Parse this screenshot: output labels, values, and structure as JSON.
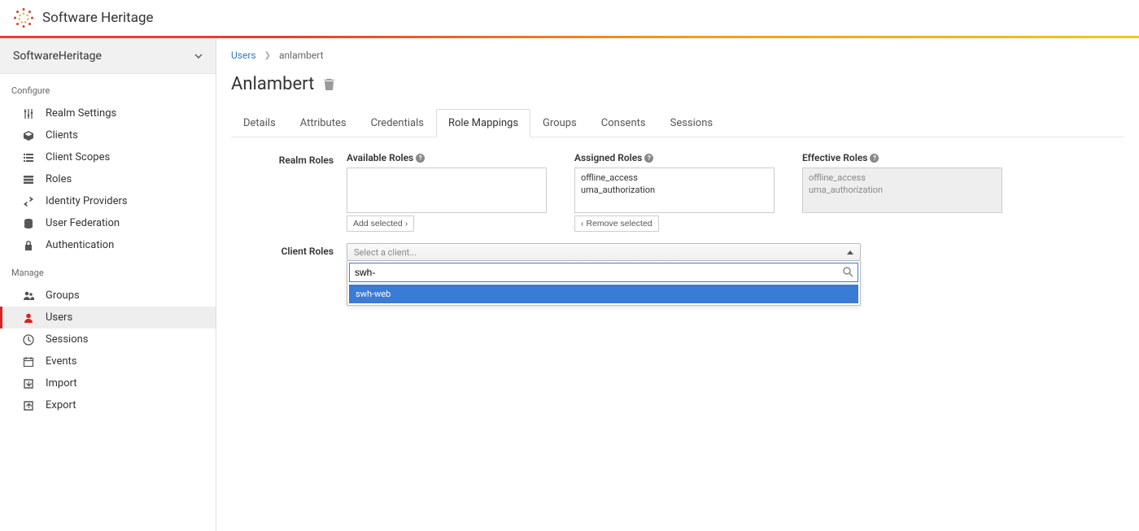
{
  "brand": {
    "text": "Software Heritage"
  },
  "realm": {
    "name": "SoftwareHeritage"
  },
  "sidebar": {
    "sections": {
      "configure_title": "Configure",
      "manage_title": "Manage"
    },
    "configure": [
      {
        "label": "Realm Settings",
        "icon": "sliders-icon"
      },
      {
        "label": "Clients",
        "icon": "cube-icon"
      },
      {
        "label": "Client Scopes",
        "icon": "list-icon"
      },
      {
        "label": "Roles",
        "icon": "layers-icon"
      },
      {
        "label": "Identity Providers",
        "icon": "exchange-icon"
      },
      {
        "label": "User Federation",
        "icon": "database-icon"
      },
      {
        "label": "Authentication",
        "icon": "lock-icon"
      }
    ],
    "manage": [
      {
        "label": "Groups",
        "icon": "group-icon"
      },
      {
        "label": "Users",
        "icon": "user-icon"
      },
      {
        "label": "Sessions",
        "icon": "clock-icon"
      },
      {
        "label": "Events",
        "icon": "calendar-icon"
      },
      {
        "label": "Import",
        "icon": "import-icon"
      },
      {
        "label": "Export",
        "icon": "export-icon"
      }
    ]
  },
  "breadcrumb": {
    "root": "Users",
    "current": "anlambert"
  },
  "page": {
    "title": "Anlambert"
  },
  "tabs": [
    {
      "label": "Details"
    },
    {
      "label": "Attributes"
    },
    {
      "label": "Credentials"
    },
    {
      "label": "Role Mappings"
    },
    {
      "label": "Groups"
    },
    {
      "label": "Consents"
    },
    {
      "label": "Sessions"
    }
  ],
  "role_mapping": {
    "realm_roles_label": "Realm Roles",
    "client_roles_label": "Client Roles",
    "available_label": "Available Roles",
    "assigned_label": "Assigned Roles",
    "effective_label": "Effective Roles",
    "add_selected_btn": "Add selected",
    "remove_selected_btn": "Remove selected",
    "assigned": [
      "offline_access",
      "uma_authorization"
    ],
    "effective": [
      "offline_access",
      "uma_authorization"
    ],
    "client_select_placeholder": "Select a client...",
    "client_search_value": "swh-",
    "client_options": [
      "swh-web"
    ]
  }
}
